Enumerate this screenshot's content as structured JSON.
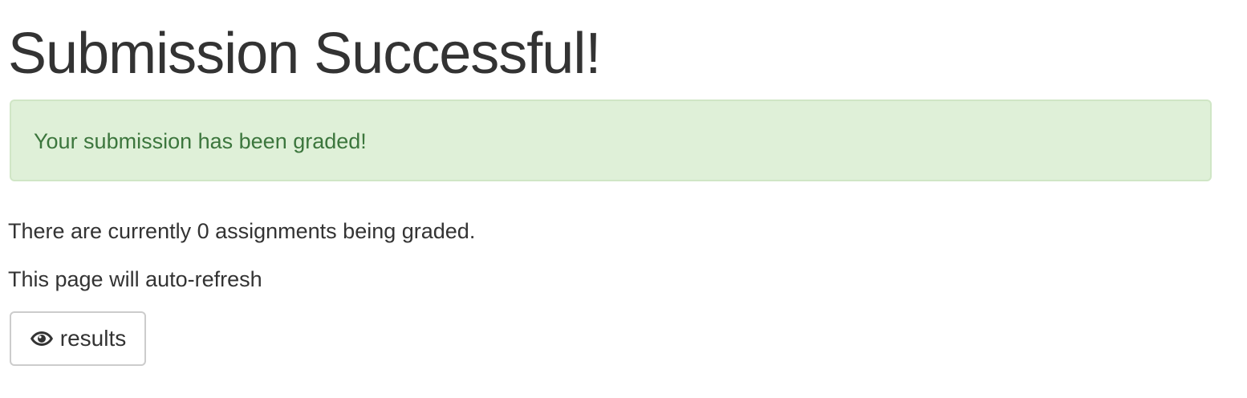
{
  "page": {
    "title": "Submission Successful!"
  },
  "alert": {
    "message": "Your submission has been graded!",
    "background": "#dff0d8",
    "text_color": "#3c763d",
    "border_color": "#d0e6c6"
  },
  "status": {
    "queue_text": "There are currently 0 assignments being graded.",
    "refresh_text": "This page will auto-refresh"
  },
  "actions": {
    "results_button": {
      "label": "results",
      "icon": "eye-icon"
    }
  }
}
